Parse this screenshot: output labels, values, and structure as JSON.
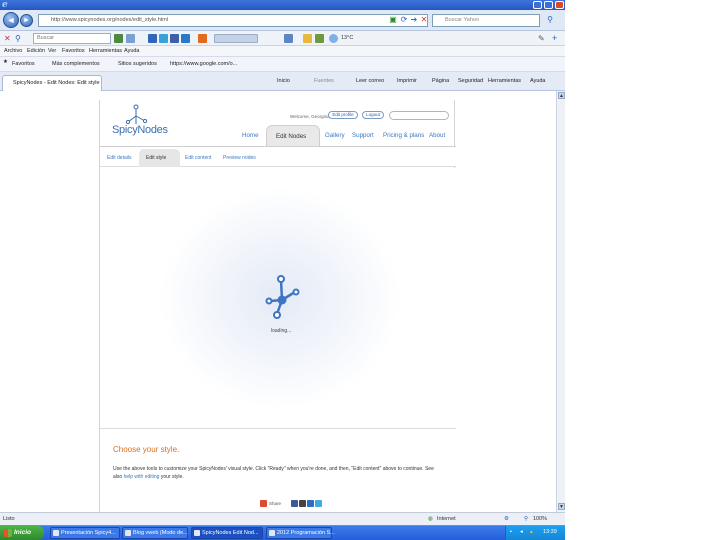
{
  "browser": {
    "address": "http://www.spicynodes.org/nodes/edit_style.html",
    "search_placeholder": "Buscar Yahoo",
    "toolbar_search": "Buscar",
    "weather": "13°C",
    "menu": [
      "Archivo",
      "Edición",
      "Ver",
      "Favoritos",
      "Herramientas",
      "Ayuda"
    ],
    "favorites": [
      "Favoritos",
      "Más complementos",
      "Sitios sugeridos",
      "https://www.google.com/o..."
    ],
    "tab_title": "SpicyNodes - Edit Nodes: Edit style",
    "commands": [
      "Inicio",
      "Fuentes",
      "Leer correo",
      "Imprimir",
      "Página",
      "Seguridad",
      "Herramientas",
      "Ayuda"
    ]
  },
  "site": {
    "logo": "SpicyNodes",
    "welcome": "Welcome, Georgina",
    "edit_profile": "Edit profile",
    "logout": "Logout",
    "nav": {
      "home": "Home",
      "edit_nodes": "Edit Nodes",
      "gallery": "Gallery",
      "support": "Support",
      "pricing": "Pricing & plans",
      "about": "About"
    },
    "subnav": {
      "edit_details": "Edit details",
      "edit_style": "Edit style",
      "edit_content": "Edit content",
      "preview": "Preview nodes"
    },
    "loading": "loading...",
    "choose_title": "Choose your style.",
    "choose_text": "Use the above tools to customize your SpicyNodes' visual style. Click \"Ready\" when you're done, and then, \"Edit content\" above to continue. See also",
    "choose_link": "help with editing",
    "choose_end": "your style.",
    "share": "Share",
    "brand_color": "#3a78c0",
    "accent_color": "#e0701b"
  },
  "status": {
    "left": "Listo",
    "zone": "Internet",
    "zoom": "100%"
  },
  "taskbar": {
    "start": "Inicio",
    "tasks": [
      "Presentación Spicy4...",
      "Blog vweb (Modo de...",
      "SpicyNodes Edit Nod...",
      "2012 Programación S..."
    ],
    "clock": "13:39"
  }
}
